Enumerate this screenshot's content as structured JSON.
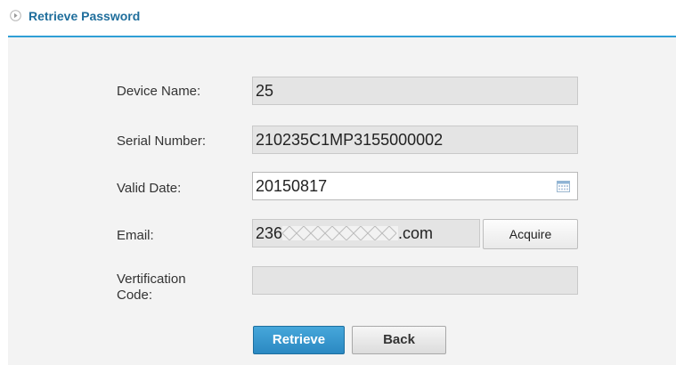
{
  "header": {
    "title": "Retrieve Password",
    "icon": "circle-play-icon"
  },
  "form": {
    "device_name": {
      "label": "Device Name:",
      "value": "25"
    },
    "serial_number": {
      "label": "Serial Number:",
      "value": "210235C1MP3155000002"
    },
    "valid_date": {
      "label": "Valid Date:",
      "value": "20150817",
      "icon": "calendar-icon"
    },
    "email": {
      "label": "Email:",
      "value_prefix": "236",
      "value_suffix": ".com",
      "masked": true
    },
    "verification_code": {
      "label_line1": "Vertification",
      "label_line2": "Code:",
      "value": ""
    }
  },
  "buttons": {
    "acquire": "Acquire",
    "retrieve": "Retrieve",
    "back": "Back"
  },
  "colors": {
    "accent": "#2f9fd6",
    "title": "#1f6e9c",
    "primary_button": "#2b89c2",
    "panel_bg": "#f3f3f3"
  }
}
